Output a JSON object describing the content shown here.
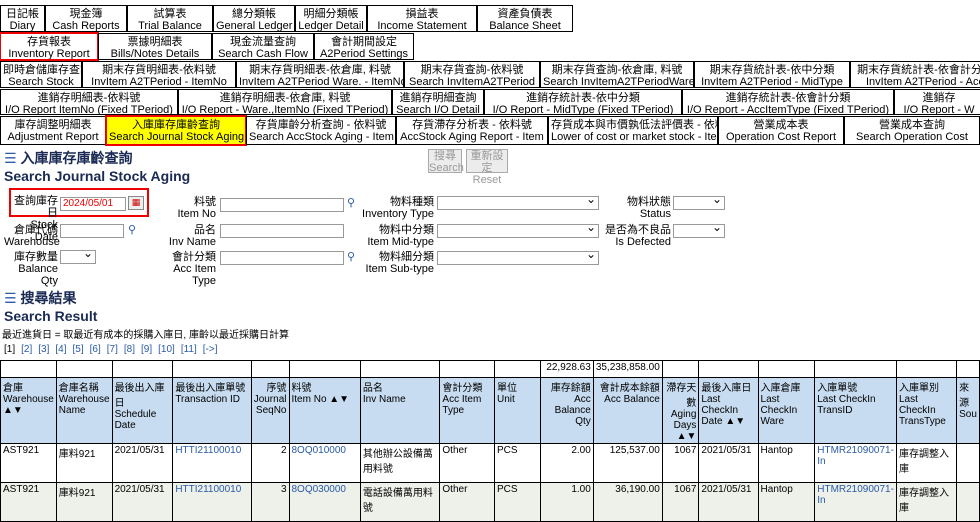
{
  "tabs_row1": [
    {
      "zh": "日記帳",
      "en": "Diary"
    },
    {
      "zh": "現金簿",
      "en": "Cash Reports"
    },
    {
      "zh": "試算表",
      "en": "Trial Balance"
    },
    {
      "zh": "總分類帳",
      "en": "General Ledger"
    },
    {
      "zh": "明細分類帳",
      "en": "Ledger Detail"
    },
    {
      "zh": "損益表",
      "en": "Income Statement"
    },
    {
      "zh": "資產負債表",
      "en": "Balance Sheet"
    }
  ],
  "tabs_row2": [
    {
      "zh": "存貨報表",
      "en": "Inventory Report"
    },
    {
      "zh": "票據明細表",
      "en": "Bills/Notes Details"
    },
    {
      "zh": "現金流量查詢",
      "en": "Search Cash Flow"
    },
    {
      "zh": "會計期間設定",
      "en": "A2Period Settings"
    }
  ],
  "tabs_row3": [
    {
      "zh": "即時倉儲庫存查詢",
      "en": "Search Stock"
    },
    {
      "zh": "期末存貨明細表-依料號",
      "en": "InvItem A2TPeriod - ItemNo"
    },
    {
      "zh": "期末存貨明細表-依倉庫, 料號",
      "en": "InvItem A2TPeriod Ware. - ItemNo"
    },
    {
      "zh": "期末存貨查詢-依料號",
      "en": "Search InvItemA2TPeriod"
    },
    {
      "zh": "期末存貨查詢-依倉庫, 料號",
      "en": "Search InvItemA2TPeriodWare"
    },
    {
      "zh": "期末存貨統計表-依中分類",
      "en": "InvItem A2TPeriod - MidType"
    },
    {
      "zh": "期末存貨統計表-依會計分類",
      "en": "InvItem A2TPeriod - Acc"
    }
  ],
  "tabs_row4": [
    {
      "zh": "進銷存明細表-依料號",
      "en": "I/O Report ItemNo (Fixed TPeriod)"
    },
    {
      "zh": "進銷存明細表-依倉庫, 料號",
      "en": "I/O Report - Ware.,ItemNo (Fixed TPeriod)"
    },
    {
      "zh": "進銷存明細查詢",
      "en": "Search I/O Detail"
    },
    {
      "zh": "進銷存統計表-依中分類",
      "en": "I/O Report - MidType (Fixed TPeriod)"
    },
    {
      "zh": "進銷存統計表-依會計分類",
      "en": "I/O Report - AccItemType (Fixed TPeriod)"
    },
    {
      "zh": "進銷存",
      "en": "I/O Report - W"
    }
  ],
  "tabs_row5": [
    {
      "zh": "庫存調整明細表",
      "en": "Adjustment Report"
    },
    {
      "zh": "入庫庫存庫齡查詢",
      "en": "Search Journal Stock Aging"
    },
    {
      "zh": "存貨庫齡分析查詢 - 依料號",
      "en": "Search AccStock Aging - Item"
    },
    {
      "zh": "存貨滯存分析表 - 依料號",
      "en": "AccStock Aging Report - Item"
    },
    {
      "zh": "存貨成本與市價孰低法評價表 - 依料號",
      "en": "Lower of cost or market stock - Item"
    },
    {
      "zh": "營業成本表",
      "en": "Operation Cost Report"
    },
    {
      "zh": "營業成本查詢",
      "en": "Search Operation Cost"
    }
  ],
  "page": {
    "title_zh": "入庫庫存庫齡查詢",
    "title_en": "Search Journal Stock Aging",
    "result_zh": "搜尋結果",
    "result_en": "Search Result",
    "note": "最近進貨日 = 取最近有成本的採購入庫日, 庫齡以最近採購日計算"
  },
  "buttons": {
    "search_zh": "搜尋",
    "search_en": "Search",
    "reset_zh": "重新設定",
    "reset_en": "Reset"
  },
  "form": {
    "stock_date_zh": "查詢庫存日",
    "stock_date_en": "Stock Date",
    "stock_date_value": "2024/05/01",
    "item_no_zh": "料號",
    "item_no_en": "Item No",
    "inv_type_zh": "物料種類",
    "inv_type_en": "Inventory Type",
    "status_zh": "物料狀態",
    "status_en": "Status",
    "warehouse_zh": "倉庫代碼",
    "warehouse_en": "Warehouse",
    "inv_name_zh": "品名",
    "inv_name_en": "Inv Name",
    "mid_type_zh": "物料中分類",
    "mid_type_en": "Item Mid-type",
    "defected_zh": "是否為不良品",
    "defected_en": "Is Defected",
    "bal_qty_zh": "庫存數量",
    "bal_qty_en": "Balance Qty",
    "acc_type_zh": "會計分類",
    "acc_type_en": "Acc Item Type",
    "sub_type_zh": "物料細分類",
    "sub_type_en": "Item Sub-type"
  },
  "pager": [
    "[1]",
    "[2]",
    "[3]",
    "[4]",
    "[5]",
    "[6]",
    "[7]",
    "[8]",
    "[9]",
    "[10]",
    "[11]",
    "[->]"
  ],
  "totals": {
    "qty": "22,928.63",
    "amount": "35,238,858.00"
  },
  "columns": [
    [
      "倉庫",
      "Warehouse ▲▼"
    ],
    [
      "倉庫名稱",
      "Warehouse Name"
    ],
    [
      "最後出入庫日",
      "Schedule Date"
    ],
    [
      "最後出入庫單號",
      "Transaction ID"
    ],
    [
      "序號",
      "Journal SeqNo"
    ],
    [
      "料號",
      "Item No ▲▼"
    ],
    [
      "品名",
      "Inv Name"
    ],
    [
      "會計分類",
      "Acc Item Type"
    ],
    [
      "單位",
      "Unit"
    ],
    [
      "庫存餘額",
      "Acc Balance Qty"
    ],
    [
      "會計成本餘額",
      "Acc Balance"
    ],
    [
      "滯存天數",
      "Aging Days ▲▼"
    ],
    [
      "最後入庫日",
      "Last CheckIn Date ▲▼"
    ],
    [
      "入庫倉庫",
      "Last CheckIn Ware"
    ],
    [
      "入庫單號",
      "Last CheckIn TransID"
    ],
    [
      "入庫單別",
      "Last CheckIn TransType"
    ],
    [
      "來源",
      "Sou"
    ]
  ],
  "rows": [
    [
      "AST921",
      "庫料921",
      "2021/05/31",
      "HTTI21100010",
      "2",
      "8OQ010000",
      "其他辦公設備萬用料號",
      "Other",
      "PCS",
      "2.00",
      "125,537.00",
      "1067",
      "2021/05/31",
      "Hantop",
      "HTMR21090071-In",
      "庫存調整入庫",
      ""
    ],
    [
      "AST921",
      "庫料921",
      "2021/05/31",
      "HTTI21100010",
      "3",
      "8OQ030000",
      "電話設備萬用料號",
      "Other",
      "PCS",
      "1.00",
      "36,190.00",
      "1067",
      "2021/05/31",
      "Hantop",
      "HTMR21090071-In",
      "庫存調整入庫",
      ""
    ]
  ],
  "colors": {
    "yellow": "#ffff00",
    "header_blue": "#c7dcf0",
    "link": "#2a5aa8",
    "red": "#e00000"
  }
}
